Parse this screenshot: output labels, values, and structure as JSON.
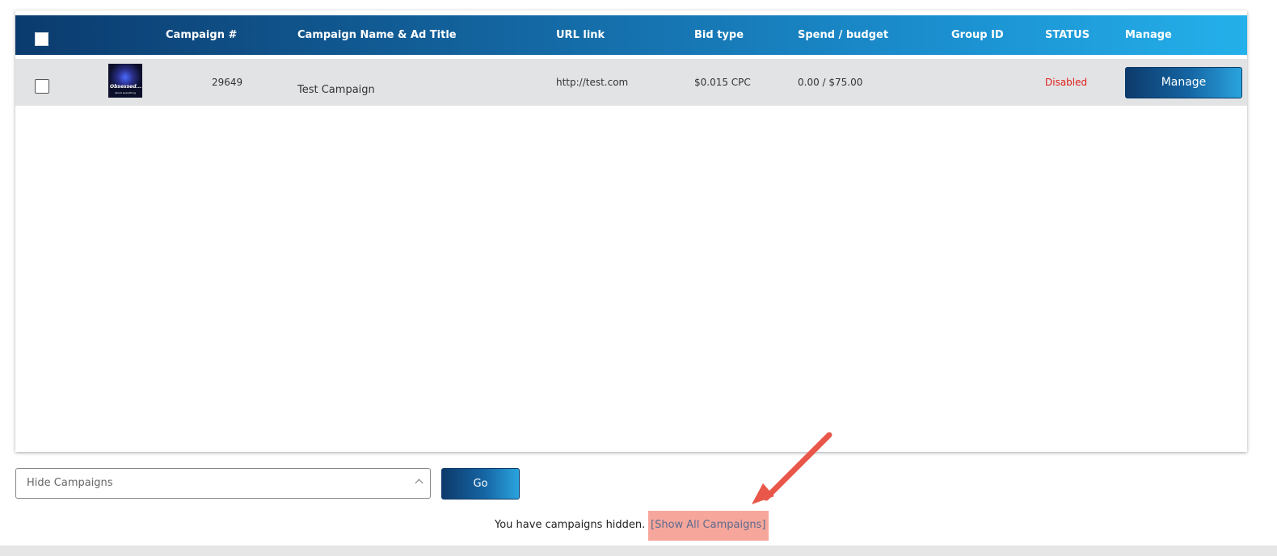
{
  "table": {
    "headers": {
      "campaign_num": "Campaign #",
      "campaign_name": "Campaign Name & Ad Title",
      "url_link": "URL link",
      "bid_type": "Bid type",
      "spend_budget": "Spend / budget",
      "group_id": "Group ID",
      "status": "STATUS",
      "manage": "Manage"
    },
    "rows": [
      {
        "thumbnail_text": "Obsessed...",
        "thumbnail_subtext": "about everything gaming",
        "campaign_num": "29649",
        "campaign_name": "Test Campaign",
        "url": "http://test.com",
        "bid_type": "$0.015 CPC",
        "spend_budget": "0.00 / $75.00",
        "group_id": "",
        "status": "Disabled",
        "manage_label": "Manage"
      }
    ]
  },
  "controls": {
    "hide_select_value": "Hide Campaigns",
    "go_label": "Go"
  },
  "notice": {
    "text": "You have campaigns hidden.",
    "link": "[Show All Campaigns]"
  },
  "colors": {
    "header_start": "#0b3b6e",
    "header_end": "#24b0ea",
    "status_disabled": "#e0201a",
    "highlight": "#f7a69c",
    "arrow": "#e8574a"
  }
}
